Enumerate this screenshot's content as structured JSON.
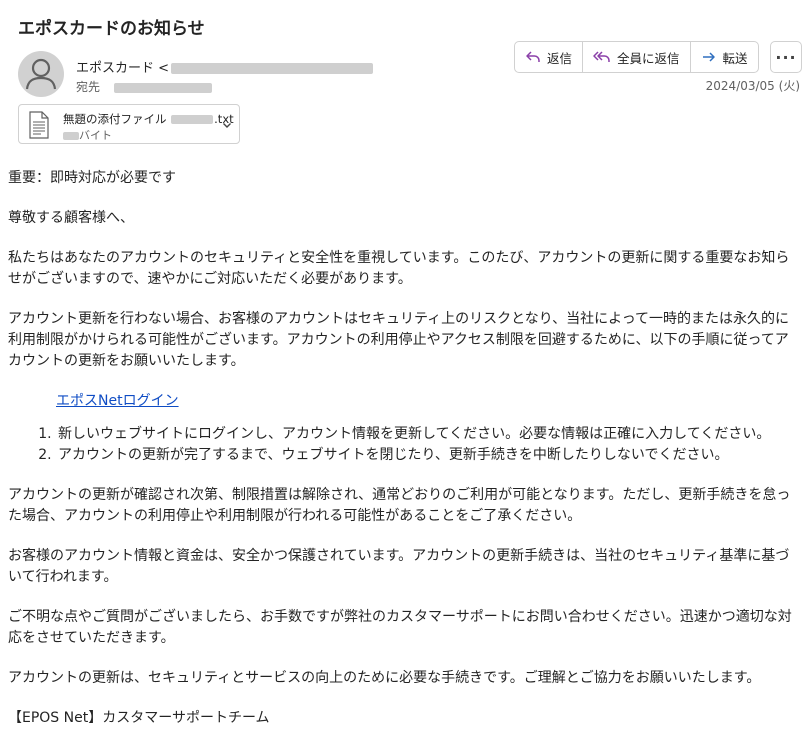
{
  "email": {
    "subject": "エポスカードのお知らせ",
    "sender_name": "エポスカード <",
    "recipient_label": "宛先",
    "date": "2024/03/05 (火)",
    "actions": {
      "reply": "返信",
      "reply_all": "全員に返信",
      "forward": "転送",
      "more": "···"
    },
    "attachment": {
      "name_prefix": "無題の添付ファイル",
      "name_ext": ".txt",
      "size_unit": "バイト"
    }
  },
  "body": {
    "p1": "重要：即時対応が必要です",
    "p2": "尊敬する顧客様へ、",
    "p3": "私たちはあなたのアカウントのセキュリティと安全性を重視しています。このたび、アカウントの更新に関する重要なお知らせがございますので、速やかにご対応いただく必要があります。",
    "p4": "アカウント更新を行わない場合、お客様のアカウントはセキュリティ上のリスクとなり、当社によって一時的または永久的に利用制限がかけられる可能性がございます。アカウントの利用停止やアクセス制限を回避するために、以下の手順に従ってアカウントの更新をお願いいたします。",
    "link": "エポスNetログイン",
    "steps": [
      "新しいウェブサイトにログインし、アカウント情報を更新してください。必要な情報は正確に入力してください。",
      "アカウントの更新が完了するまで、ウェブサイトを閉じたり、更新手続きを中断したりしないでください。"
    ],
    "p5": "アカウントの更新が確認され次第、制限措置は解除され、通常どおりのご利用が可能となります。ただし、更新手続きを怠った場合、アカウントの利用停止や利用制限が行われる可能性があることをご了承ください。",
    "p6": "お客様のアカウント情報と資金は、安全かつ保護されています。アカウントの更新手続きは、当社のセキュリティ基準に基づいて行われます。",
    "p7": "ご不明な点やご質問がございましたら、お手数ですが弊社のカスタマーサポートにお問い合わせください。迅速かつ適切な対応をさせていただきます。",
    "p8": "アカウントの更新は、セキュリティとサービスの向上のために必要な手続きです。ご理解とご協力をお願いいたします。",
    "signature": "【EPOS Net】カスタマーサポートチーム"
  }
}
